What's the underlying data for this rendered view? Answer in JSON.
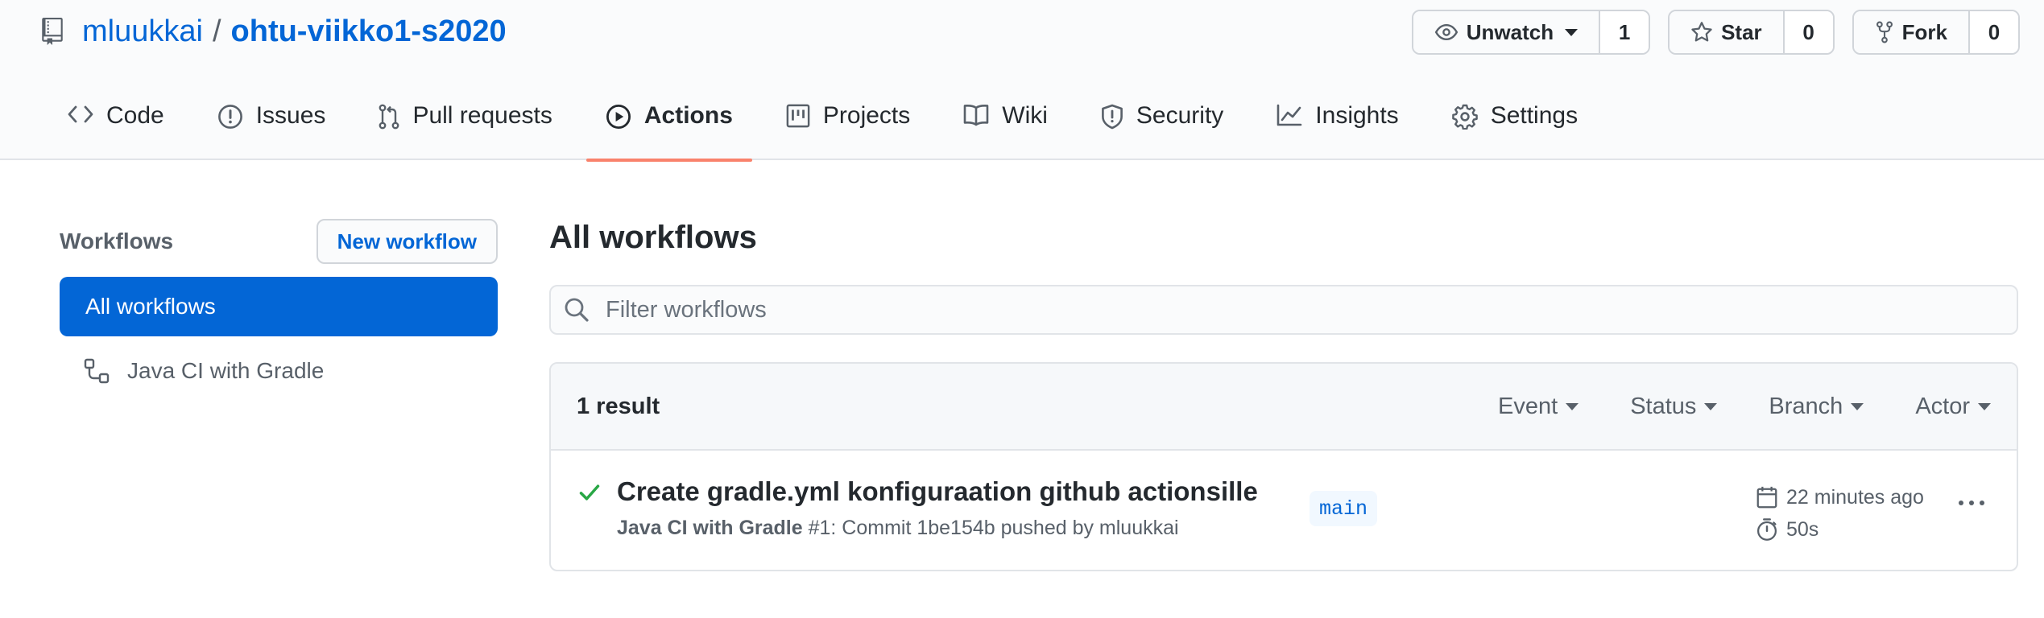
{
  "repo": {
    "owner": "mluukkai",
    "separator": "/",
    "name": "ohtu-viikko1-s2020"
  },
  "actions": {
    "watch": {
      "label": "Unwatch",
      "count": "1"
    },
    "star": {
      "label": "Star",
      "count": "0"
    },
    "fork": {
      "label": "Fork",
      "count": "0"
    }
  },
  "nav": {
    "code": "Code",
    "issues": "Issues",
    "pulls": "Pull requests",
    "actions": "Actions",
    "projects": "Projects",
    "wiki": "Wiki",
    "security": "Security",
    "insights": "Insights",
    "settings": "Settings",
    "selected": "Actions",
    "selected_underline_color": "#f9826c"
  },
  "sidebar": {
    "title": "Workflows",
    "new_workflow": "New workflow",
    "items": [
      {
        "label": "All workflows",
        "selected": true
      },
      {
        "label": "Java CI with Gradle",
        "selected": false,
        "icon": "workflow-icon"
      }
    ]
  },
  "main": {
    "title": "All workflows",
    "filter_placeholder": "Filter workflows",
    "result_count": "1 result",
    "filters": {
      "event": "Event",
      "status": "Status",
      "branch": "Branch",
      "actor": "Actor"
    },
    "runs": [
      {
        "status": "success",
        "title": "Create gradle.yml konfiguraation github actionsille",
        "workflow": "Java CI with Gradle",
        "meta": " #1: Commit 1be154b pushed by mluukkai",
        "branch": "main",
        "time_ago": "22 minutes ago",
        "duration": "50s"
      }
    ]
  },
  "colors": {
    "link": "#0366d6",
    "selected_bg": "#0366d6",
    "success": "#28a745",
    "muted": "#586069"
  }
}
